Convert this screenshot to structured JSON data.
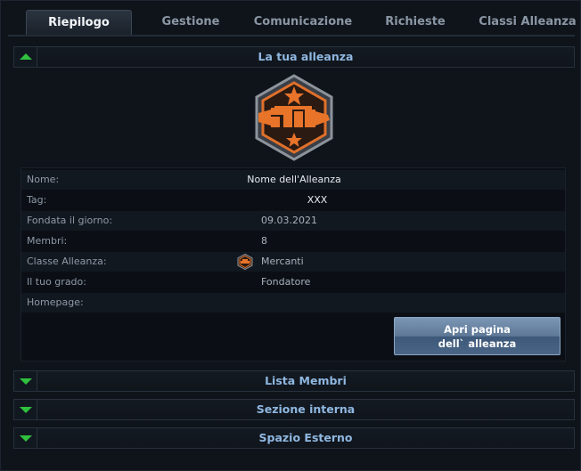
{
  "tabs": [
    {
      "label": "Riepilogo",
      "active": true
    },
    {
      "label": "Gestione",
      "active": false
    },
    {
      "label": "Comunicazione",
      "active": false
    },
    {
      "label": "Richieste",
      "active": false
    },
    {
      "label": "Classi Alleanza",
      "active": false
    }
  ],
  "sections": {
    "alliance": "La tua alleanza",
    "members": "Lista Membri",
    "internal": "Sezione interna",
    "external": "Spazio Esterno"
  },
  "info": {
    "name_label": "Nome:",
    "name_value": "Nome dell'Alleanza",
    "tag_label": "Tag:",
    "tag_value": "XXX",
    "founded_label": "Fondata il giorno:",
    "founded_value": "09.03.2021",
    "members_label": "Membri:",
    "members_value": "8",
    "class_label": "Classe Alleanza:",
    "class_value": "Mercanti",
    "rank_label": "Il tuo grado:",
    "rank_value": "Fondatore",
    "homepage_label": "Homepage:",
    "homepage_value": ""
  },
  "button": {
    "line1": "Apri pagina",
    "line2": "dell` alleanza"
  },
  "colors": {
    "accent_green": "#2fc03e",
    "section_title": "#8fb7e0",
    "emblem_orange": "#e0702a"
  }
}
